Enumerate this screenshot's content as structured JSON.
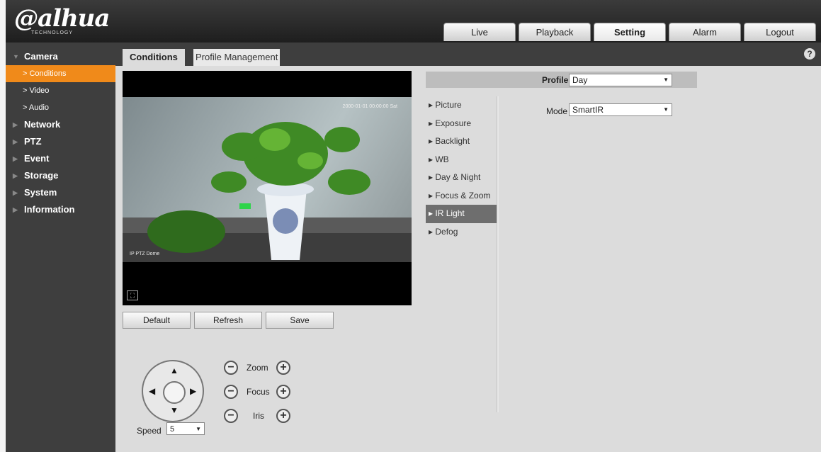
{
  "logo": {
    "brand": "alhua",
    "tagline": "TECHNOLOGY"
  },
  "nav": [
    "Live",
    "Playback",
    "Setting",
    "Alarm",
    "Logout"
  ],
  "nav_active": "Setting",
  "sidebar": {
    "camera": "Camera",
    "camera_items": [
      "Conditions",
      "Video",
      "Audio"
    ],
    "sections": [
      "Network",
      "PTZ",
      "Event",
      "Storage",
      "System",
      "Information"
    ]
  },
  "tabs": {
    "conditions": "Conditions",
    "profile_management": "Profile Management"
  },
  "video": {
    "timestamp": "2000-01-01 00:00:00 Sat",
    "camera_name": "IP PTZ Dome"
  },
  "buttons": {
    "default": "Default",
    "refresh": "Refresh",
    "save": "Save"
  },
  "ptz": {
    "zoom": "Zoom",
    "focus": "Focus",
    "iris": "Iris",
    "speed_label": "Speed",
    "speed_value": "5"
  },
  "profile": {
    "label": "Profile",
    "value": "Day"
  },
  "mode": {
    "label": "Mode",
    "value": "SmartIR"
  },
  "menu": [
    "Picture",
    "Exposure",
    "Backlight",
    "WB",
    "Day & Night",
    "Focus & Zoom",
    "IR Light",
    "Defog"
  ],
  "menu_active": "IR Light",
  "icons": {
    "help": "help-icon",
    "fullscreen": "fullscreen-icon"
  }
}
